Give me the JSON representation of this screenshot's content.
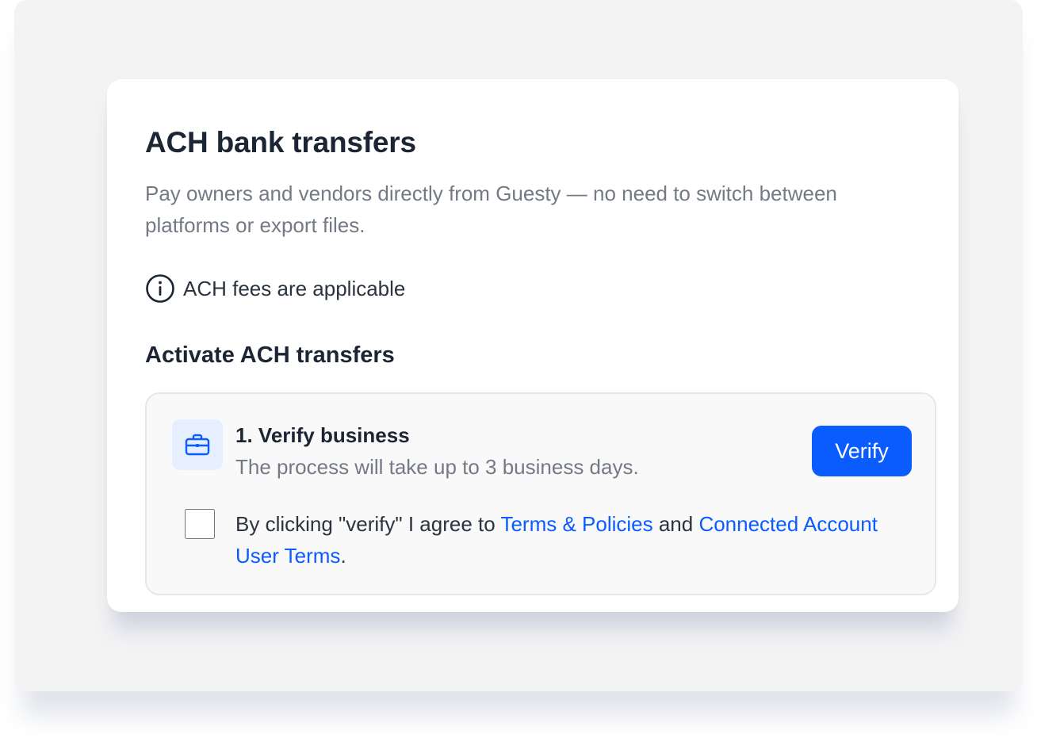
{
  "card": {
    "title": "ACH bank transfers",
    "description": "Pay owners and vendors directly from Guesty — no need to switch between platforms or export files.",
    "fees_notice": "ACH fees are applicable",
    "activate_heading": "Activate ACH transfers"
  },
  "step": {
    "icon": "briefcase-icon",
    "title": "1. Verify business",
    "subtitle": "The process will take up to 3 business days.",
    "verify_label": "Verify",
    "agreement": {
      "prefix": "By clicking \"verify\" I agree to ",
      "terms_link": "Terms & Policies",
      "middle": " and ",
      "account_link": "Connected Account User Terms",
      "suffix": ".",
      "checked": false
    }
  },
  "colors": {
    "accent": "#0b5cff",
    "icon_bg": "#e6efff",
    "text_primary": "#1c2533",
    "text_secondary": "#747a85"
  }
}
